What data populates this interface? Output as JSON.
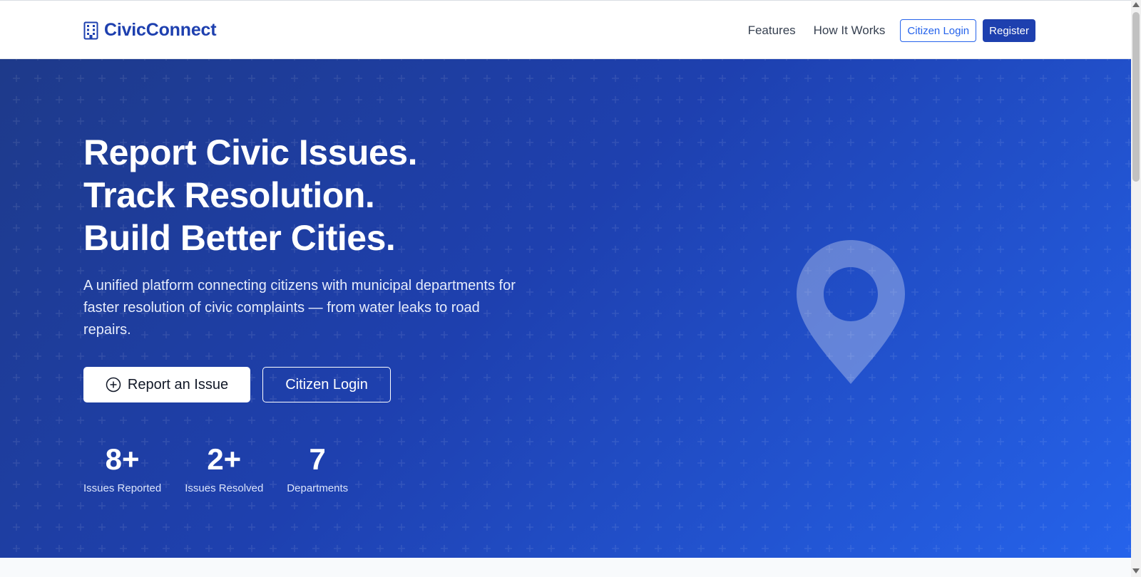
{
  "brand": {
    "name": "CivicConnect",
    "icon": "building-icon"
  },
  "nav": {
    "links": [
      "Features",
      "How It Works"
    ],
    "login_label": "Citizen Login",
    "register_label": "Register"
  },
  "hero": {
    "title_lines": [
      "Report Civic Issues.",
      "Track Resolution.",
      "Build Better Cities."
    ],
    "description": "A unified platform connecting citizens with municipal departments for faster resolution of civic complaints — from water leaks to road repairs.",
    "primary_cta": {
      "label": "Report an Issue",
      "icon": "plus-circle-icon"
    },
    "secondary_cta": {
      "label": "Citizen Login"
    },
    "stats": [
      {
        "value": "8+",
        "label": "Issues Reported"
      },
      {
        "value": "2+",
        "label": "Issues Resolved"
      },
      {
        "value": "7",
        "label": "Departments"
      }
    ],
    "illustration": "map-pin-icon"
  },
  "colors": {
    "brand": "#1e40af",
    "accent": "#2563eb",
    "hero_start": "#1e3a8a",
    "hero_end": "#2563eb"
  }
}
